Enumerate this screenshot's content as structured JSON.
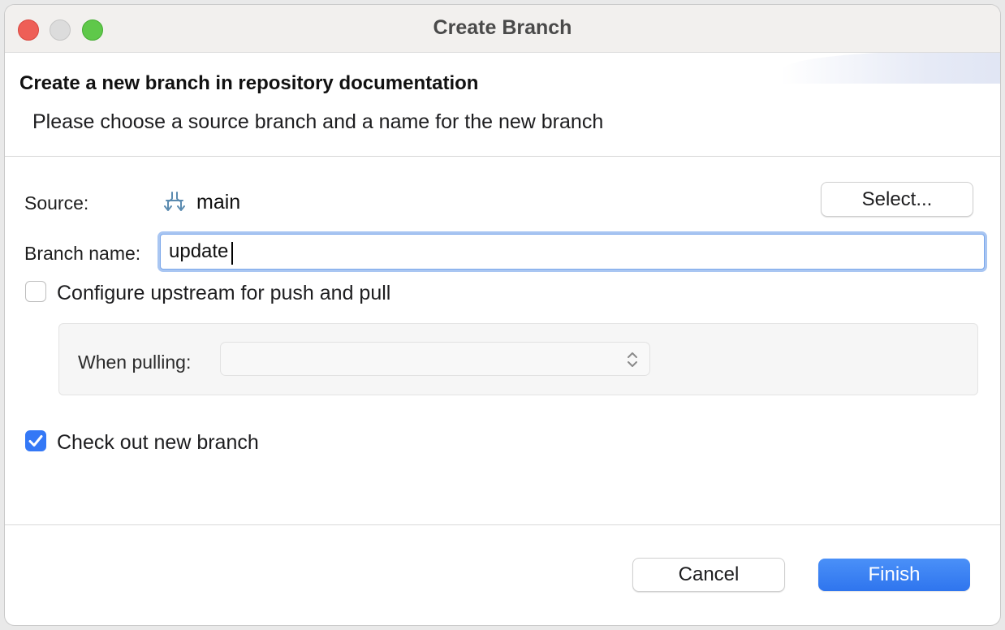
{
  "window": {
    "title": "Create Branch"
  },
  "header": {
    "title": "Create a new branch in repository documentation",
    "description": "Please choose a source branch and a name for the new branch"
  },
  "form": {
    "source_label": "Source:",
    "source_value": "main",
    "select_button": "Select...",
    "branch_name_label": "Branch name:",
    "branch_name_value": "update",
    "configure_upstream_label": "Configure upstream for push and pull",
    "configure_upstream_checked": false,
    "when_pulling_label": "When pulling:",
    "when_pulling_value": "",
    "checkout_label": "Check out new branch",
    "checkout_checked": true
  },
  "footer": {
    "cancel_label": "Cancel",
    "finish_label": "Finish"
  },
  "icons": {
    "source": "branch-icon",
    "select_arrows": "chevron-up-down-icon",
    "checkmark": "checkmark-icon"
  },
  "colors": {
    "accent": "#3478f6",
    "close": "#ee5f57",
    "maximize": "#5fc84a"
  }
}
